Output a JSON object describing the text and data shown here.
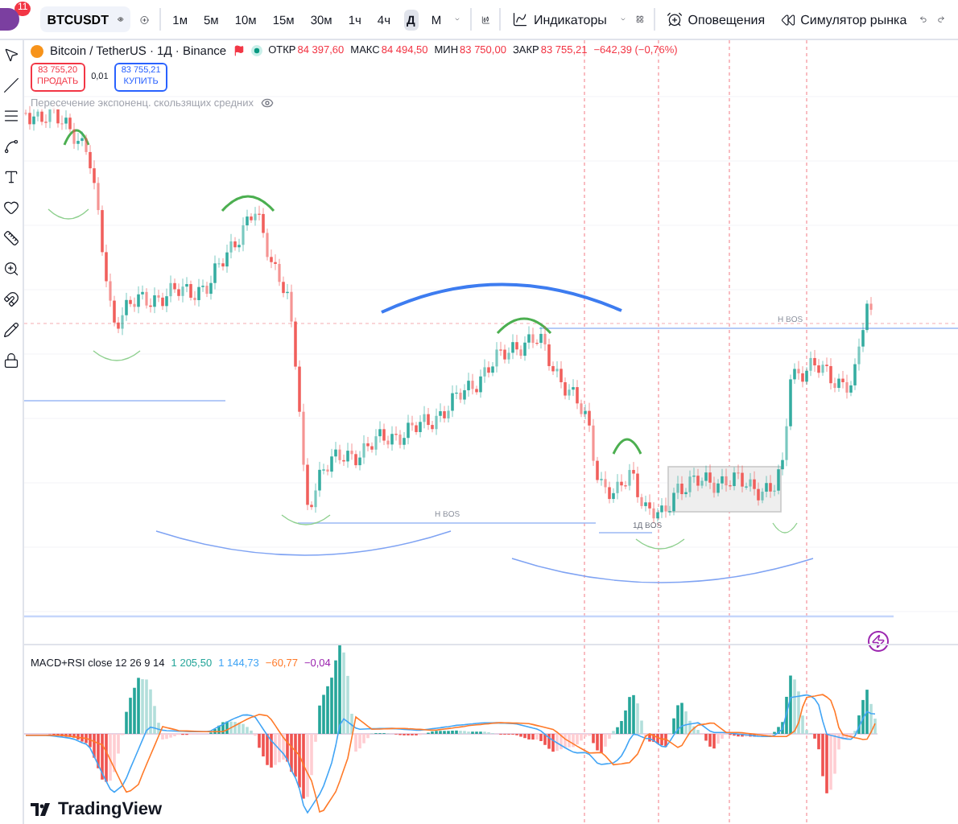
{
  "toolbar": {
    "badge": "11",
    "symbol": "BTCUSDT",
    "intervals": [
      {
        "label": "1м",
        "selected": false
      },
      {
        "label": "5м",
        "selected": false
      },
      {
        "label": "10м",
        "selected": false
      },
      {
        "label": "15м",
        "selected": false
      },
      {
        "label": "30м",
        "selected": false
      },
      {
        "label": "1ч",
        "selected": false
      },
      {
        "label": "4ч",
        "selected": false
      },
      {
        "label": "Д",
        "selected": true
      },
      {
        "label": "М",
        "selected": false
      }
    ],
    "indicators": "Индикаторы",
    "alerts": "Оповещения",
    "simulator": "Симулятор рынка"
  },
  "legend": {
    "title": "Bitcoin / TetherUS · 1Д · Binance",
    "ohlc": [
      {
        "label": "ОТКР",
        "value": "84 397,60"
      },
      {
        "label": "МАКС",
        "value": "84 494,50"
      },
      {
        "label": "МИН",
        "value": "83 750,00"
      },
      {
        "label": "ЗАКР",
        "value": "83 755,21"
      }
    ],
    "change": "−642,39 (−0,76%)"
  },
  "trade": {
    "sell_price": "83 755,20",
    "sell_label": "ПРОДАТЬ",
    "spread": "0,01",
    "buy_price": "83 755,21",
    "buy_label": "КУПИТЬ"
  },
  "indicator_label": "Пересечение экспоненц. скользящих средних",
  "chart_labels": [
    {
      "text": "Н BOS",
      "kind": "week"
    },
    {
      "text": "1Д BOS",
      "kind": "day"
    },
    {
      "text": "Н BOS",
      "kind": "week"
    }
  ],
  "macd": {
    "title": "MACD+RSI close 12 26 9 14",
    "values": [
      {
        "text": "1 205,50",
        "color": "#26a69a"
      },
      {
        "text": "1 144,73",
        "color": "#42a5f5"
      },
      {
        "text": "−60,77",
        "color": "#ff7a29"
      },
      {
        "text": "−0,04",
        "color": "#9c27b0"
      }
    ]
  },
  "brand": "TradingView"
}
